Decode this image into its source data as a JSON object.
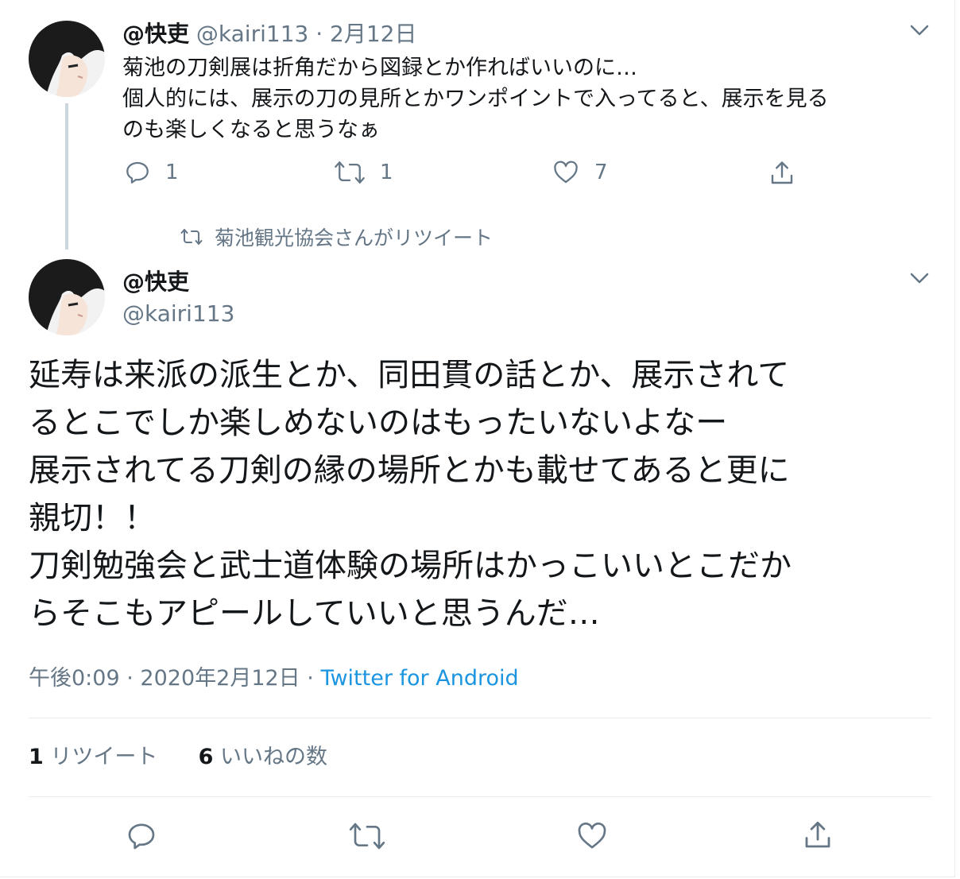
{
  "reply_tweet": {
    "display_name": "@快吏",
    "handle": "@kairi113",
    "separator": "·",
    "date": "2月12日",
    "text_lines": [
      "菊池の刀剣展は折角だから図録とか作ればいいのに…",
      "個人的には、展示の刀の見所とかワンポイントで入ってると、展示を見る",
      "のも楽しくなると思うなぁ"
    ],
    "reply_count": "1",
    "retweet_count": "1",
    "like_count": "7",
    "icons": [
      "reply-icon",
      "retweet-icon",
      "like-icon",
      "share-icon",
      "chevron-down-icon"
    ]
  },
  "retweet_context": {
    "label": "菊池観光協会さんがリツイート",
    "icon": "retweet-icon"
  },
  "main_tweet": {
    "display_name": "@快吏",
    "handle": "@kairi113",
    "text_lines": [
      "延寿は来派の派生とか、同田貫の話とか、展示されて",
      "るとこでしか楽しめないのはもったいないよなー",
      "展示されてる刀剣の縁の場所とかも載せてあると更に",
      "親切！！",
      "刀剣勉強会と武士道体験の場所はかっこいいとこだか",
      "らそこもアピールしていいと思うんだ…"
    ],
    "time": "午後0:09",
    "separator": "·",
    "date": "2020年2月12日",
    "separator2": "·",
    "source": "Twitter for Android",
    "retweets_count": "1",
    "retweets_label": "リツイート",
    "likes_count": "6",
    "likes_label": "いいねの数",
    "icons": [
      "reply-icon",
      "retweet-icon",
      "like-icon",
      "share-icon",
      "chevron-down-icon"
    ]
  },
  "colors": {
    "text": "#14171a",
    "secondary": "#657786",
    "link": "#1b95e0",
    "divider": "#e6ecf0",
    "thread_line": "#ccd6dd"
  }
}
